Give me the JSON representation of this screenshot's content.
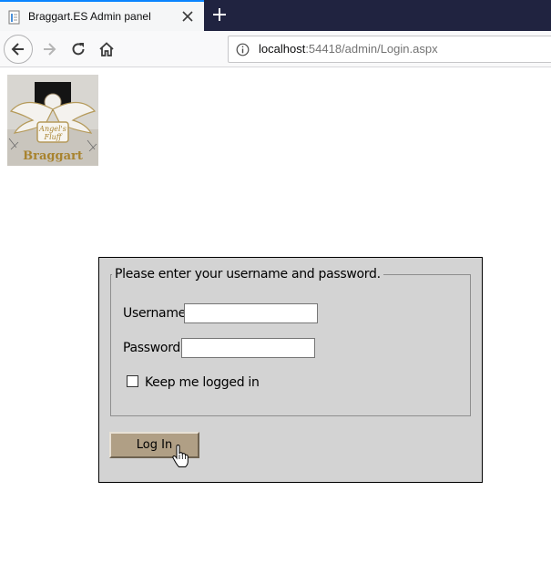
{
  "browser": {
    "tab": {
      "title": "Braggart.ES Admin panel",
      "close_icon": "close-icon",
      "favicon": "page-icon"
    },
    "new_tab_icon": "plus-icon",
    "nav": {
      "back_icon": "arrow-left-icon",
      "forward_icon": "arrow-right-icon",
      "reload_icon": "reload-icon",
      "home_icon": "home-icon"
    },
    "url": {
      "info_icon": "info-icon",
      "host": "localhost",
      "rest": ":54418/admin/Login.aspx"
    }
  },
  "page": {
    "logo": {
      "text_top": "Angel's Fluff",
      "text_bottom": "Braggart"
    },
    "login": {
      "legend": "Please enter your username and password.",
      "username_label": "Username:",
      "username_value": "",
      "password_label": "Password:",
      "password_value": "",
      "remember_label": "Keep me logged in",
      "remember_checked": false,
      "submit_label": "Log In"
    },
    "colors": {
      "panel_bg": "#d3d3d3",
      "button_bg": "#b09f85",
      "tabstrip_bg": "#202340",
      "tab_accent": "#0a84ff"
    }
  }
}
